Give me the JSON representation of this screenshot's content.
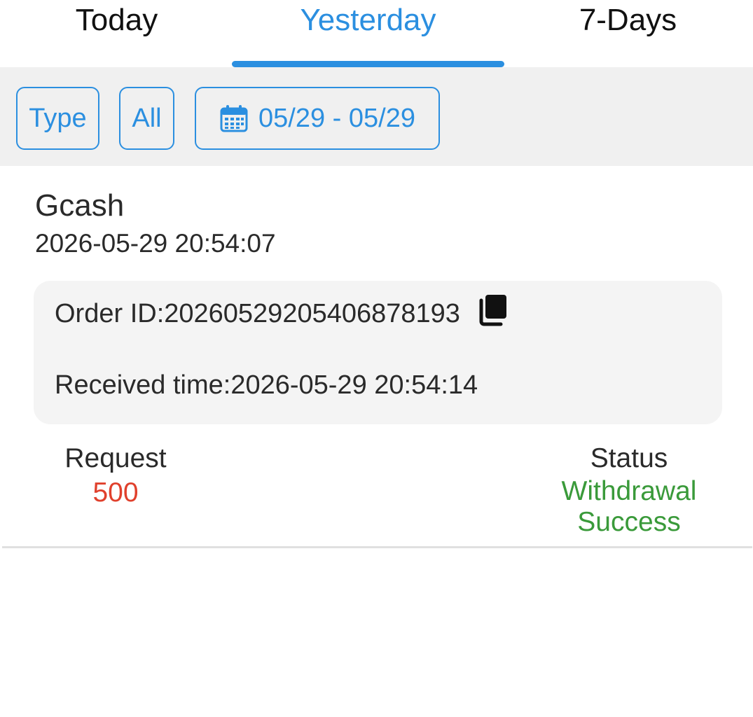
{
  "tabs": {
    "today": "Today",
    "yesterday": "Yesterday",
    "seven_days": "7-Days",
    "active": "Yesterday"
  },
  "filters": {
    "type_label": "Type",
    "all_label": "All",
    "date_range": "05/29 - 05/29",
    "date_icon": "calendar-icon"
  },
  "record": {
    "method": "Gcash",
    "created_at": "2026-05-29 20:54:07",
    "order_id": "Order ID:20260529205406878193",
    "copy_icon": "copy-icon",
    "received_time": "Received time:2026-05-29 20:54:14",
    "request_label": "Request",
    "request_value": "500",
    "status_label": "Status",
    "status_value_line1": "Withdrawal",
    "status_value_line2": "Success"
  },
  "colors": {
    "accent": "#2b8fe0",
    "request_value": "#e0402c",
    "status_success": "#3a9a3a",
    "filter_bar_bg": "#f0f0f0",
    "detail_bg": "#f4f4f4"
  }
}
